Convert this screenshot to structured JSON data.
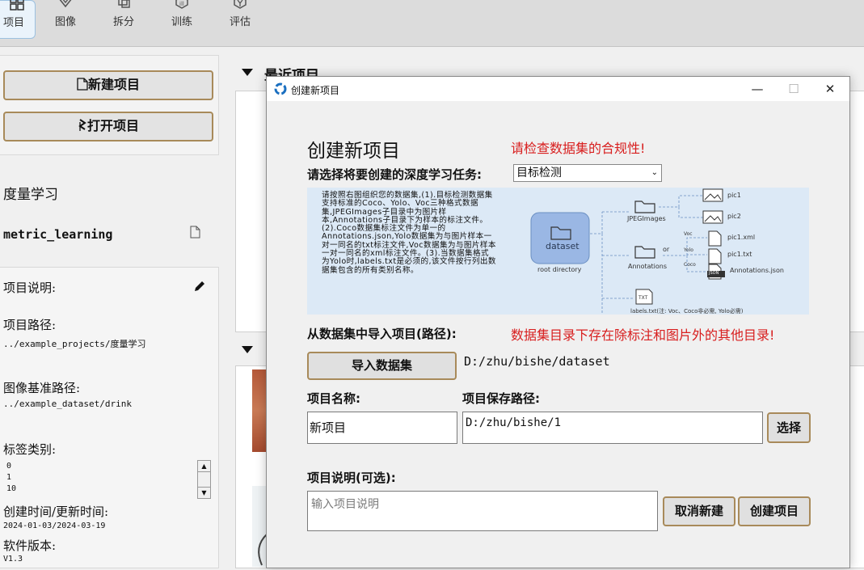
{
  "toolbar": {
    "tabs": [
      {
        "label": "项目",
        "icon": "grid-icon"
      },
      {
        "label": "图像",
        "icon": "image-icon"
      },
      {
        "label": "拆分",
        "icon": "split-icon"
      },
      {
        "label": "训练",
        "icon": "train-icon"
      },
      {
        "label": "评估",
        "icon": "evaluate-icon"
      }
    ]
  },
  "left": {
    "new_project": "新建项目",
    "open_project": "打开项目",
    "project_name": "度量学习",
    "project_key": "metric_learning",
    "desc_label": "项目说明:",
    "path_label": "项目路径:",
    "path_value": "../example_projects/度量学习",
    "image_base_label": "图像基准路径:",
    "image_base_value": "../example_dataset/drink",
    "tags_label": "标签类别:",
    "tags": [
      "0",
      "1",
      "10"
    ],
    "time_label": "创建时间/更新时间:",
    "time_value": "2024-01-03/2024-03-19",
    "version_label": "软件版本:",
    "version_value": "V1.3"
  },
  "main": {
    "recent_title": "最近项目"
  },
  "dialog": {
    "window_title": "创建新项目",
    "heading": "创建新项目",
    "warning1": "请检查数据集的合规性!",
    "task_label": "请选择将要创建的深度学习任务:",
    "task_value": "目标检测",
    "guide": {
      "text": "请按照右图组织您的数据集,(1).目标检测数据集支持标准的Coco、Yolo、Voc三种格式数据集,JPEGImages子目录中为图片样本,Annotations子目录下为样本的标注文件。(2).Coco数据集标注文件为单一的Annotations.json,Yolo数据集为与图片样本一对一同名的txt标注文件,Voc数据集为与图片样本一对一同名的xml标注文件。(3).当数据集格式为Yolo时,labels.txt是必须的,该文件按行列出数据集包含的所有类别名称。",
      "dataset": "dataset",
      "root": "root directory",
      "jpeg": "JPEGImages",
      "annotations": "Annotations",
      "pic1": "pic1",
      "pic2": "pic2",
      "voc": "Voc",
      "yolo": "Yolo",
      "coco": "Coco",
      "or": "or",
      "pic1xml": "pic1.xml",
      "pic1txt": "pic1.txt",
      "annjson": "Annotations.json",
      "json_badge": "JSON",
      "txt_badge": "TXT",
      "labels": "labels.txt(注: Voc、Coco非必需, Yolo必需)"
    },
    "import_label": "从数据集中导入项目(路径):",
    "warning2": "数据集目录下存在除标注和图片外的其他目录!",
    "import_button": "导入数据集",
    "dataset_path": "D:/zhu/bishe/dataset",
    "name_label": "项目名称:",
    "name_value": "新项目",
    "save_label": "项目保存路径:",
    "save_value": "D:/zhu/bishe/1",
    "choose_button": "选择",
    "desc_label": "项目说明(可选):",
    "desc_placeholder": "输入项目说明",
    "cancel_button": "取消新建",
    "create_button": "创建项目"
  }
}
